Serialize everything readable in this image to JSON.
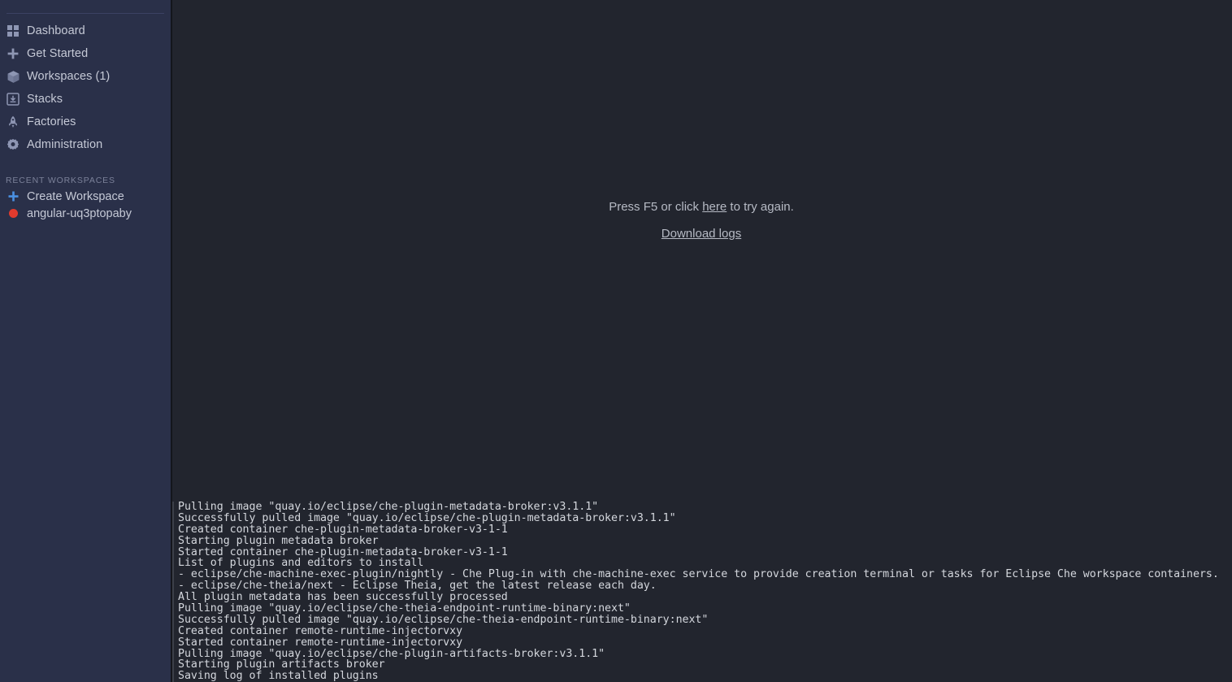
{
  "theme": {
    "sidebar_bg": "#2a3049",
    "main_bg": "#22252e",
    "accent_blue": "#4a90e2",
    "status_red": "#e23b2e",
    "text_primary": "#c5c9d6",
    "text_muted": "#7b8199",
    "log_text": "#d4d7dd"
  },
  "sidebar": {
    "items": [
      {
        "label": "Dashboard",
        "icon": "grid-icon",
        "count": ""
      },
      {
        "label": "Get Started",
        "icon": "plus-icon",
        "count": ""
      },
      {
        "label": "Workspaces",
        "icon": "cube-icon",
        "count": "(1)"
      },
      {
        "label": "Stacks",
        "icon": "stack-icon",
        "count": ""
      },
      {
        "label": "Factories",
        "icon": "rocket-icon",
        "count": ""
      },
      {
        "label": "Administration",
        "icon": "gear-icon",
        "count": ""
      }
    ],
    "recent": {
      "heading": "RECENT WORKSPACES",
      "items": [
        {
          "label": "Create Workspace",
          "icon": "plus-icon",
          "status_color": ""
        },
        {
          "label": "angular-uq3ptopaby",
          "icon": "status-dot-icon",
          "status_color": "#e23b2e"
        }
      ]
    }
  },
  "main": {
    "retry_prefix": "Press F5 or click ",
    "retry_link": "here",
    "retry_suffix": " to try again.",
    "download_logs": "Download logs"
  },
  "log": {
    "lines": [
      "Pulling image \"quay.io/eclipse/che-plugin-metadata-broker:v3.1.1\"",
      "Successfully pulled image \"quay.io/eclipse/che-plugin-metadata-broker:v3.1.1\"",
      "Created container che-plugin-metadata-broker-v3-1-1",
      "Starting plugin metadata broker",
      "Started container che-plugin-metadata-broker-v3-1-1",
      "List of plugins and editors to install",
      "- eclipse/che-machine-exec-plugin/nightly - Che Plug-in with che-machine-exec service to provide creation terminal or tasks for Eclipse Che workspace containers.",
      "- eclipse/che-theia/next - Eclipse Theia, get the latest release each day.",
      "All plugin metadata has been successfully processed",
      "Pulling image \"quay.io/eclipse/che-theia-endpoint-runtime-binary:next\"",
      "Successfully pulled image \"quay.io/eclipse/che-theia-endpoint-runtime-binary:next\"",
      "Created container remote-runtime-injectorvxy",
      "Started container remote-runtime-injectorvxy",
      "Pulling image \"quay.io/eclipse/che-plugin-artifacts-broker:v3.1.1\"",
      "Starting plugin artifacts broker",
      "Saving log of installed plugins"
    ]
  }
}
